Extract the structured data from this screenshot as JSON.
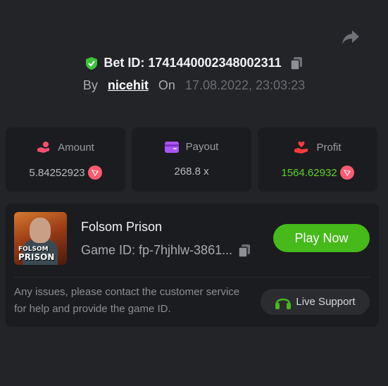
{
  "bet": {
    "label": "Bet ID: 1741440002348002311",
    "by_label": "By",
    "username": "nicehit",
    "on_label": "On",
    "datetime": "17.08.2022, 23:03:23"
  },
  "stats": {
    "amount": {
      "label": "Amount",
      "value": "5.84252923"
    },
    "payout": {
      "label": "Payout",
      "value": "268.8 x"
    },
    "profit": {
      "label": "Profit",
      "value": "1564.62932"
    }
  },
  "game": {
    "title": "Folsom Prison",
    "id_text": "Game ID: fp-7hjhlw-3861...",
    "thumb_line1": "FOLSOM",
    "thumb_line2": "PRISON",
    "play_label": "Play Now",
    "notice": "Any issues, please contact the customer service for help and provide the game ID.",
    "support_label": "Live Support"
  },
  "colors": {
    "background": "#232427",
    "card": "#1b1c1f",
    "accent_green": "#46b91b",
    "profit_green": "#5fd12a",
    "coin_red": "#ff5b70",
    "amount_icon": "#ff4f6e",
    "payout_icon": "#a855f7",
    "profit_icon": "#ff3b3b"
  },
  "icons": [
    "share-icon",
    "shield-check-icon",
    "copy-icon",
    "hand-coin-icon",
    "wallet-icon",
    "hand-heart-icon",
    "coin-icon",
    "headset-icon"
  ]
}
